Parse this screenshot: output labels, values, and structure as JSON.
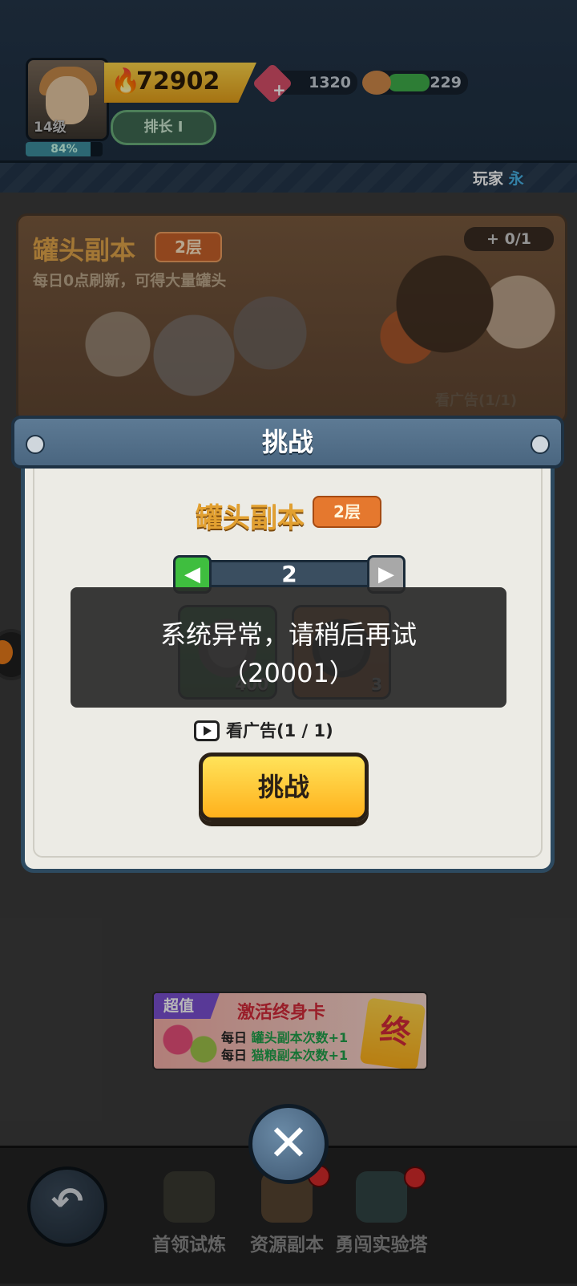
{
  "header": {
    "level": "14级",
    "xp_percent_label": "84%",
    "xp_fraction": 0.84,
    "power": "72902",
    "rank_label": "排长 I",
    "gems": "1320",
    "food": "229",
    "player_label": "玩家",
    "player_name": "永"
  },
  "dungeon_card": {
    "title": "罐头副本",
    "floor": "2层",
    "description": "每日0点刷新，可得大量罐头",
    "count": "+ 0/1",
    "ad_label": "看广告(1/1)"
  },
  "modal": {
    "title": "挑战",
    "dungeon_title": "罐头副本",
    "floor": "2层",
    "stepper_value": "2",
    "rewards": [
      {
        "name": "can",
        "qty": "400"
      },
      {
        "name": "dog-tag",
        "qty": "3"
      }
    ],
    "ad_label": "看广告(1 / 1)",
    "challenge_button": "挑战"
  },
  "toast": {
    "line1": "系统异常，请稍后再试",
    "line2": "（20001）"
  },
  "promo": {
    "tag": "超值",
    "title": "激活终身卡",
    "line1_prefix": "每日",
    "line1_hl": "罐头副本次数+1",
    "line2_prefix": "每日",
    "line2_hl": "猫粮副本次数+1",
    "card_glyph": "终"
  },
  "bottom_nav": {
    "items": [
      {
        "label": "首领试炼",
        "icon": "boss-icon"
      },
      {
        "label": "资源副本",
        "icon": "resource-icon"
      },
      {
        "label": "勇闯实验塔",
        "icon": "tower-icon"
      }
    ]
  },
  "colors": {
    "accent_gold": "#ffb11c",
    "modal_frame": "#2d4a60",
    "promo_red": "#d42a3a"
  }
}
